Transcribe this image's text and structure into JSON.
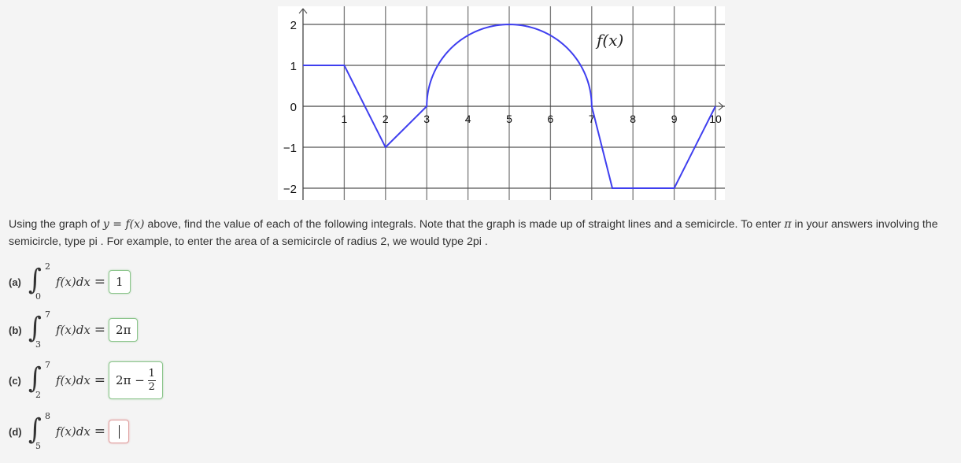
{
  "chart_data": {
    "type": "line",
    "title": "",
    "curve_label": "f(x)",
    "xlabel": "",
    "ylabel": "",
    "xlim": [
      -0.6,
      10.2
    ],
    "ylim": [
      -2.3,
      2.45
    ],
    "grid": true,
    "x_ticks": [
      "1",
      "2",
      "3",
      "4",
      "5",
      "6",
      "7",
      "8",
      "9",
      "10"
    ],
    "y_ticks": [
      "2",
      "1",
      "0",
      "−1",
      "−2"
    ],
    "y_tick_values": [
      2,
      1,
      0,
      -1,
      -2
    ],
    "x_tick_values": [
      1,
      2,
      3,
      4,
      5,
      6,
      7,
      8,
      9,
      10
    ],
    "series": [
      {
        "name": "f(x)",
        "color": "#3f3fef",
        "segments": [
          {
            "kind": "line",
            "points": [
              [
                0,
                1
              ],
              [
                1,
                1
              ],
              [
                2,
                -1
              ],
              [
                3,
                0
              ]
            ]
          },
          {
            "kind": "semicircle",
            "center": [
              5,
              0
            ],
            "radius": 2,
            "from": 3,
            "to": 7
          },
          {
            "kind": "line",
            "points": [
              [
                7,
                0
              ],
              [
                7.5,
                -2
              ],
              [
                9,
                -2
              ],
              [
                10,
                0
              ]
            ]
          }
        ]
      }
    ]
  },
  "prompt": {
    "part1": "Using the graph of ",
    "math_y": "y",
    "math_eq": " = ",
    "math_fx": "f(x)",
    "part2": " above, find the value of each of the following integrals. Note that the graph is made up of straight lines and a semicircle. To enter ",
    "pi": "π",
    "part3": " in your answers involving the semicircle, type pi . For example, to enter the area of a semicircle of radius 2, we would type 2pi ."
  },
  "questions": [
    {
      "label": "(a)",
      "lower": "0",
      "upper": "2",
      "integrand": "f(x)dx",
      "equals": "=",
      "answer": "1",
      "status": "correct"
    },
    {
      "label": "(b)",
      "lower": "3",
      "upper": "7",
      "integrand": "f(x)dx",
      "equals": "=",
      "answer": "2π",
      "status": "correct"
    },
    {
      "label": "(c)",
      "lower": "2",
      "upper": "7",
      "integrand": "f(x)dx",
      "equals": "=",
      "answer_main": "2π −",
      "answer_num": "1",
      "answer_den": "2",
      "status": "correct"
    },
    {
      "label": "(d)",
      "lower": "5",
      "upper": "8",
      "integrand": "f(x)dx",
      "equals": "=",
      "answer": "",
      "status": "incorrect"
    }
  ],
  "colors": {
    "curve": "#3f3fef",
    "correct_border": "#8cc58c",
    "incorrect_border": "#e0a0a0"
  }
}
